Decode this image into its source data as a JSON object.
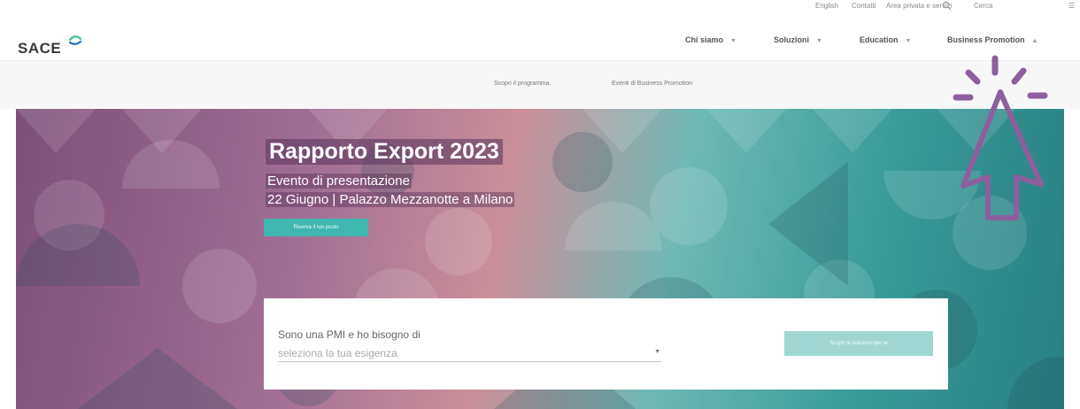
{
  "utility_bar": {
    "items": [
      "English",
      "Contatti",
      "Area privata e servizi",
      "Cerca"
    ],
    "search_icon": "search-icon",
    "menu_icon": "menu-icon"
  },
  "header": {
    "logo_text": "SACE",
    "nav": [
      {
        "label": "Chi siamo",
        "chevron": "chevron-down-icon"
      },
      {
        "label": "Soluzioni",
        "chevron": "chevron-down-icon"
      },
      {
        "label": "Education",
        "chevron": "chevron-down-icon"
      },
      {
        "label": "Business Promotion",
        "chevron": "chevron-up-icon"
      }
    ]
  },
  "subnav": {
    "items": [
      "Scopri il programma",
      "Eventi di Business Promotion"
    ]
  },
  "hero": {
    "title": "Rapporto Export 2023",
    "subtitle1": "Evento di presentazione",
    "subtitle2": "22 Giugno | Palazzo Mezzanotte a Milano",
    "button_label": "Riserva il tuo posto"
  },
  "finder": {
    "label": "Sono una PMI e ho bisogno di",
    "select_placeholder": "seleziona la tua esigenza",
    "button_label": "Scopri le soluzioni per te"
  },
  "overlay": {
    "cursor_icon": "pointer-cursor-icon"
  },
  "colors": {
    "brand_teal": "#3fb6ae",
    "cursor_purple": "#8e5f9e",
    "logo_green": "#4fbf9a",
    "logo_blue": "#2f78b8"
  }
}
